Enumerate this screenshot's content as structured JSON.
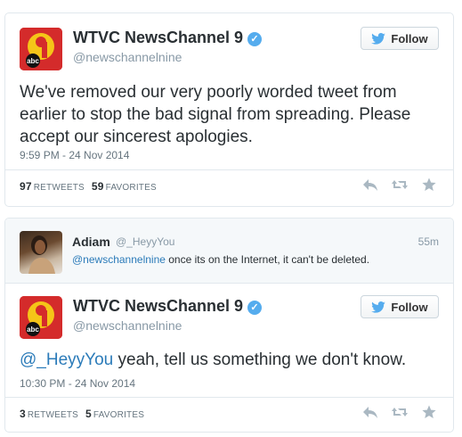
{
  "tweet1": {
    "name": "WTVC NewsChannel 9",
    "handle": "@newschannelnine",
    "follow_label": "Follow",
    "text": "We've removed our very poorly worded tweet from earlier to stop the bad signal from spreading. Please accept our sincerest apologies.",
    "timestamp": "9:59 PM - 24 Nov 2014",
    "retweets_count": "97",
    "retweets_label": "RETWEETS",
    "favorites_count": "59",
    "favorites_label": "FAVORITES",
    "avatar_text": "abc"
  },
  "reply": {
    "name": "Adiam",
    "handle": "@_HeyyYou",
    "time": "55m",
    "mention": "@newschannelnine",
    "text": " once its on the Internet, it can't be deleted."
  },
  "tweet2": {
    "name": "WTVC NewsChannel 9",
    "handle": "@newschannelnine",
    "follow_label": "Follow",
    "mention": "@_HeyyYou",
    "text": " yeah, tell us something we don't know.",
    "timestamp": "10:30 PM - 24 Nov 2014",
    "retweets_count": "3",
    "retweets_label": "RETWEETS",
    "favorites_count": "5",
    "favorites_label": "FAVORITES",
    "avatar_text": "abc"
  },
  "colors": {
    "link": "#2b7bb9",
    "verified": "#55acee",
    "twitter_bird": "#55acee",
    "logo_red": "#d42b2b",
    "logo_yellow": "#f5c518"
  }
}
